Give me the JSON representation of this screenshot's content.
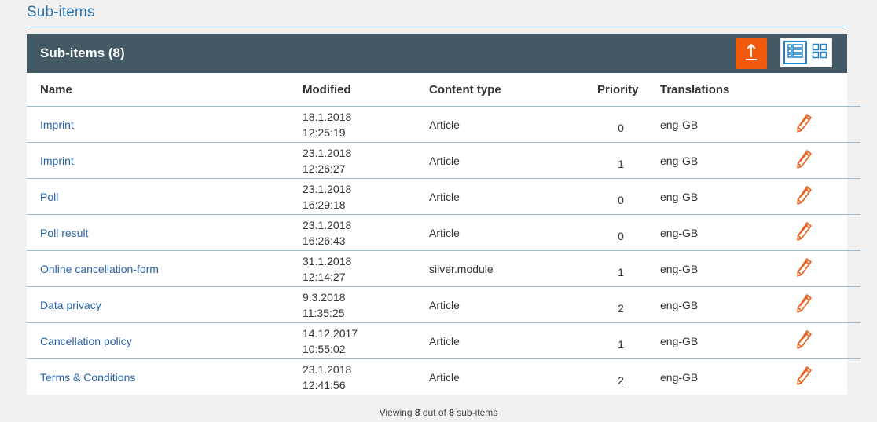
{
  "section": {
    "title": "Sub-items"
  },
  "panel": {
    "title": "Sub-items (8)",
    "upload_icon": "upload-arrow-icon",
    "view_list_icon": "list-view-icon",
    "view_grid_icon": "grid-view-icon"
  },
  "table": {
    "columns": [
      "Name",
      "Modified",
      "Content type",
      "Priority",
      "Translations",
      ""
    ],
    "rows": [
      {
        "name": "Imprint",
        "date": "18.1.2018",
        "time": "12:25:19",
        "type": "Article",
        "priority": "0",
        "translations": "eng-GB"
      },
      {
        "name": "Imprint",
        "date": "23.1.2018",
        "time": "12:26:27",
        "type": "Article",
        "priority": "1",
        "translations": "eng-GB"
      },
      {
        "name": "Poll",
        "date": "23.1.2018",
        "time": "16:29:18",
        "type": "Article",
        "priority": "0",
        "translations": "eng-GB"
      },
      {
        "name": "Poll result",
        "date": "23.1.2018",
        "time": "16:26:43",
        "type": "Article",
        "priority": "0",
        "translations": "eng-GB"
      },
      {
        "name": "Online cancellation-form",
        "date": "31.1.2018",
        "time": "12:14:27",
        "type": "silver.module",
        "priority": "1",
        "translations": "eng-GB"
      },
      {
        "name": "Data privacy",
        "date": "9.3.2018",
        "time": "11:35:25",
        "type": "Article",
        "priority": "2",
        "translations": "eng-GB"
      },
      {
        "name": "Cancellation policy",
        "date": "14.12.2017",
        "time": "10:55:02",
        "type": "Article",
        "priority": "1",
        "translations": "eng-GB"
      },
      {
        "name": "Terms & Conditions",
        "date": "23.1.2018",
        "time": "12:41:56",
        "type": "Article",
        "priority": "2",
        "translations": "eng-GB"
      }
    ]
  },
  "footer": {
    "prefix": "Viewing ",
    "shown": "8",
    "middle": " out of ",
    "total": "8",
    "suffix": " sub-items"
  },
  "colors": {
    "accent": "#f15a0d",
    "header_bg": "#435965",
    "link": "#2a62a8",
    "section_title": "#2f74a8"
  }
}
